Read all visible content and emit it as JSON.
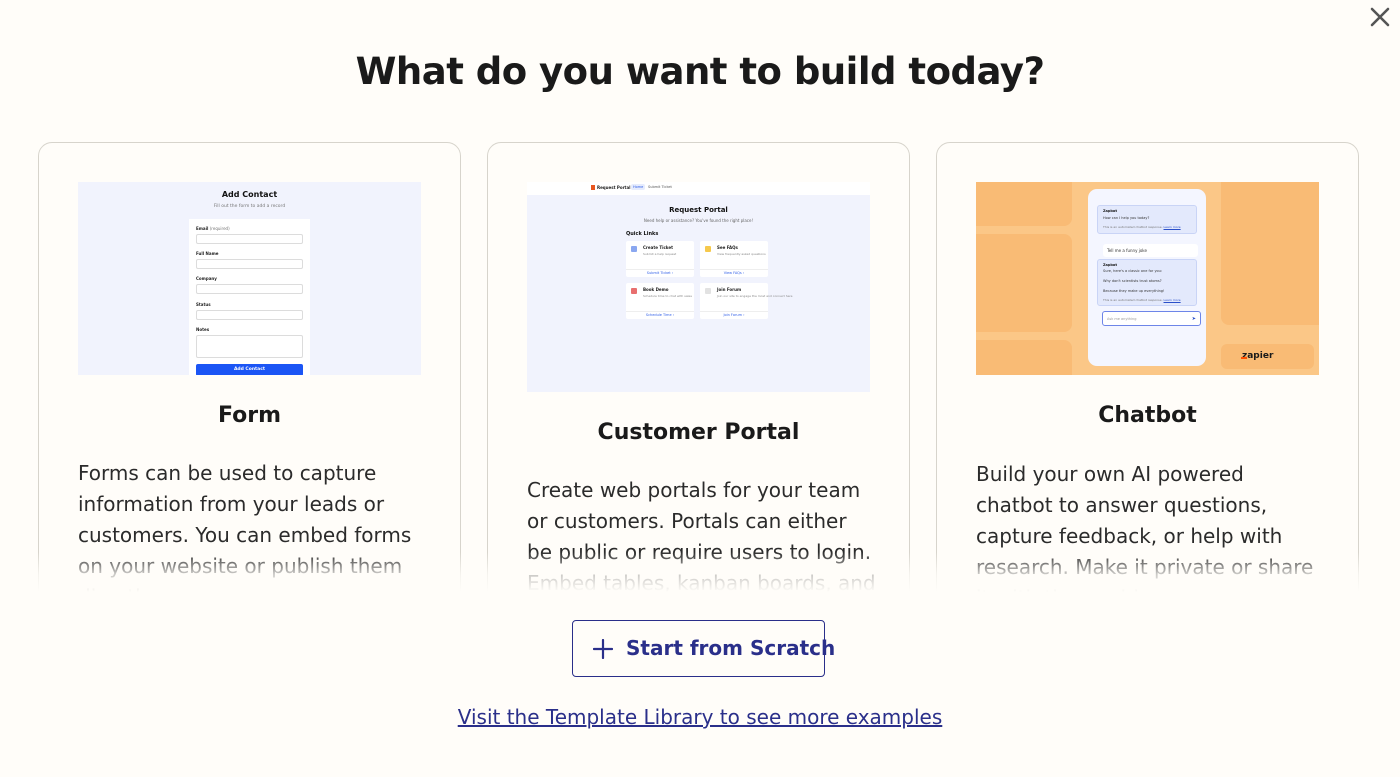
{
  "dialog": {
    "title": "What do you want to build today?",
    "close_icon": "close-icon"
  },
  "cards": {
    "form": {
      "title": "Form",
      "description": "Forms can be used to capture information from your leads or customers. You can embed forms on your website or publish them directly...",
      "preview": {
        "title": "Add Contact",
        "subtitle": "Fill out the form to add a record",
        "fields": [
          "Email",
          "Full Name",
          "Company",
          "Status",
          "Notes"
        ],
        "required_note": "(required)",
        "button": "Add Contact"
      }
    },
    "portal": {
      "title": "Customer Portal",
      "description": "Create web portals for your team or customers. Portals can either be public or require users to login. Embed tables, kanban boards, and",
      "preview": {
        "brand": "Request Portal",
        "nav": [
          "Home",
          "Submit Ticket"
        ],
        "title": "Request Portal",
        "subtitle": "Need help or assistance? You've found the right place!",
        "quick_links": "Quick Links",
        "tiles": [
          {
            "title": "Create Ticket",
            "sub": "Submit a help request",
            "link": "Submit Ticket ›"
          },
          {
            "title": "See FAQs",
            "sub": "View frequently asked questions",
            "link": "View FAQs ›"
          },
          {
            "title": "Book Demo",
            "sub": "Schedule time to chat with sales",
            "link": "Schedule Time ›"
          },
          {
            "title": "Join Forum",
            "sub": "Join our site to engage the most and connect here",
            "link": "Join Forum ›"
          }
        ]
      }
    },
    "chatbot": {
      "title": "Chatbot",
      "description": "Build your own AI powered chatbot to answer questions, capture feedback, or help with research. Make it private or share it with the world...",
      "preview": {
        "bot_name": "Zapbot",
        "greeting": "How can I help you today?",
        "disclaimer": "This is an automated chatbot response.",
        "learn_more": "Learn more",
        "user_msg": "Tell me a funny joke",
        "reply_1": "Sure, here's a classic one for you:",
        "reply_2": "Why don't scientists trust atoms?",
        "reply_3": "Because they make up everything!",
        "input_placeholder": "Ask me anything",
        "brand": "zapier"
      }
    }
  },
  "actions": {
    "scratch_label": "Start from Scratch",
    "template_link": "Visit the Template Library to see more examples"
  },
  "colors": {
    "accent": "#2a2f8a",
    "background": "#fffdf9",
    "card_border": "#d7d4cc",
    "form_button": "#1b55f5",
    "chatbot_bg": "#fbc787",
    "zapier_orange": "#ff4f00"
  }
}
